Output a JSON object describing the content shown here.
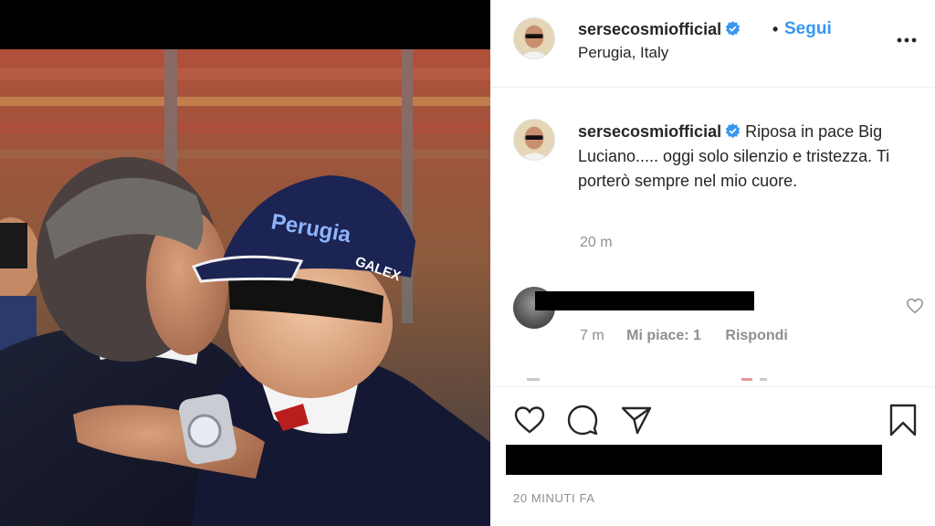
{
  "header": {
    "username": "sersecosmiofficial",
    "separator": "•",
    "follow_label": "Segui",
    "location": "Perugia, Italy"
  },
  "caption": {
    "username": "sersecosmiofficial",
    "text": "Riposa in pace Big Luciano..... oggi solo silenzio e tristezza. Ti porterò sempre nel mio cuore.",
    "time": "20 m"
  },
  "comment": {
    "time": "7 m",
    "likes": "Mi piace: 1",
    "reply_label": "Rispondi"
  },
  "photo": {
    "cap_text": "Perugia",
    "cap_brand": "GALEX"
  },
  "footer": {
    "timestamp": "20 MINUTI FA"
  },
  "icons": {
    "verified": "verified-badge-icon",
    "more": "more-options-icon",
    "like": "heart-icon",
    "comment": "comment-bubble-icon",
    "share": "paper-plane-icon",
    "save": "bookmark-icon"
  },
  "colors": {
    "link": "#3897f0",
    "verified": "#3897f0",
    "secondary_text": "#8e8e8e",
    "primary_text": "#262626"
  }
}
